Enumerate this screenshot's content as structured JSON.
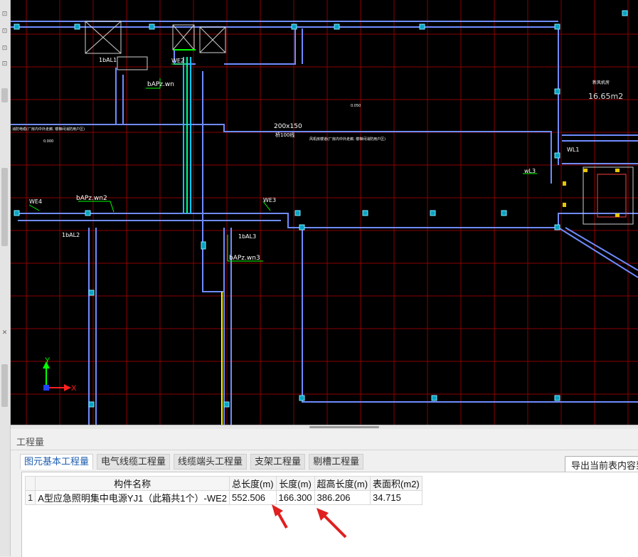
{
  "cad": {
    "labels": {
      "al1": "1bAL1",
      "al2": "1bAL2",
      "al3": "1bAL3",
      "we2": "WE2",
      "we3": "WE3",
      "we4": "WE4",
      "wl1": "WL1",
      "wl3": "wL3",
      "bapz1": "bAPz.wn",
      "bapz2": "bAPz.wn2",
      "bapz3": "bAPz.wn3",
      "bridge_size": "200x150",
      "bridge_sub": "桥100线",
      "room_area": "16.65m2",
      "room_name": "新风机房",
      "mark_0000": "0.000",
      "mark_0050": "0.050",
      "note1": "风机房楼道(厂房内中外走廊, 楼梯间消防用户区)",
      "note2": "消防电缆(厂房内中外走廊, 楼梯间消防用户区)",
      "axis_y": "Y",
      "axis_x": "X"
    }
  },
  "panel": {
    "title": "工程量",
    "tabs": [
      "图元基本工程量",
      "电气线缆工程量",
      "线缆端头工程量",
      "支架工程量",
      "剔槽工程量"
    ],
    "export_button": "导出当前表内容到"
  },
  "table": {
    "headers": [
      "构件名称",
      "总长度(m)",
      "长度(m)",
      "超高长度(m)",
      "表面积(m2)"
    ],
    "rows": [
      {
        "index": "1",
        "name": "A型应急照明集中电源YJ1（此箱共1个）-WE2",
        "total_length": "552.506",
        "length": "166.300",
        "over_height_length": "386.206",
        "surface_area": "34.715"
      }
    ]
  },
  "colors": {
    "cad_background": "#000000",
    "grid_red": "#8b0000",
    "wire_blue": "#6f8cff",
    "wire_cyan": "#00c8ff",
    "annotation_green": "#00ff00",
    "arrow_red": "#e02020",
    "active_tab_text": "#1f5fb0"
  }
}
